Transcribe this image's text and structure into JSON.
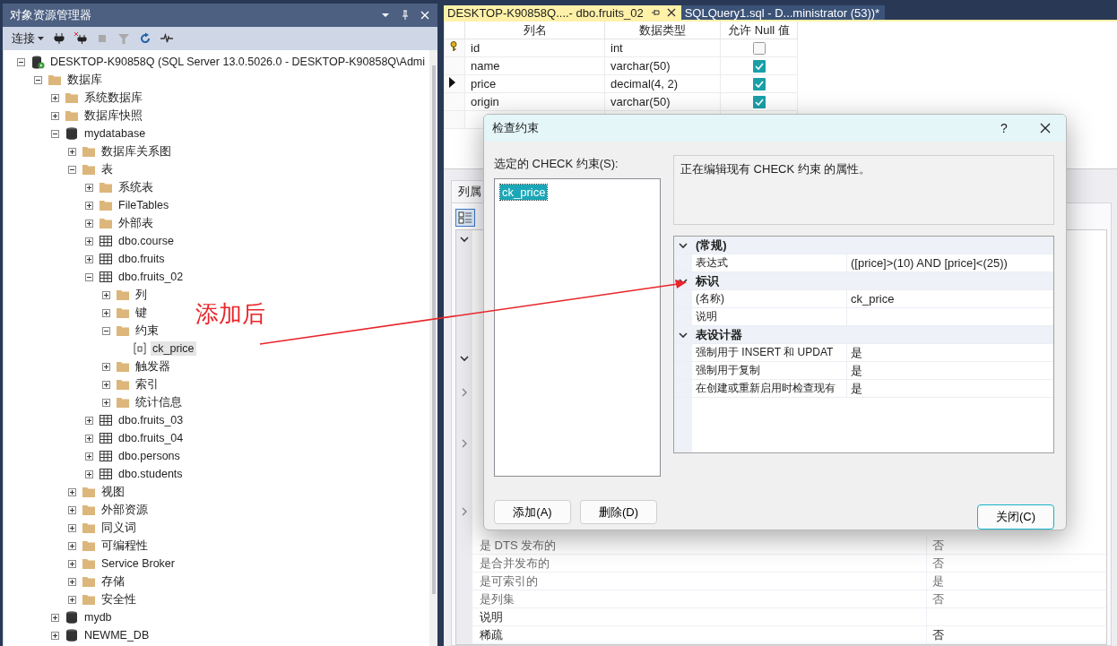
{
  "explorer": {
    "title": "对象资源管理器",
    "connect": "连接",
    "tree": [
      {
        "label": "DESKTOP-K90858Q (SQL Server 13.0.5026.0 - DESKTOP-K90858Q\\Admi",
        "kind": "server",
        "expanded": true,
        "selected": false,
        "children": [
          {
            "label": "数据库",
            "kind": "folder",
            "expanded": true,
            "selected": false,
            "children": [
              {
                "label": "系统数据库",
                "kind": "folder",
                "expanded": false,
                "selected": false
              },
              {
                "label": "数据库快照",
                "kind": "folder",
                "expanded": false,
                "selected": false
              },
              {
                "label": "mydatabase",
                "kind": "database",
                "expanded": true,
                "selected": false,
                "children": [
                  {
                    "label": "数据库关系图",
                    "kind": "folder",
                    "expanded": false,
                    "selected": false
                  },
                  {
                    "label": "表",
                    "kind": "folder",
                    "expanded": true,
                    "selected": false,
                    "children": [
                      {
                        "label": "系统表",
                        "kind": "folder",
                        "expanded": false,
                        "selected": false
                      },
                      {
                        "label": "FileTables",
                        "kind": "folder",
                        "expanded": false,
                        "selected": false
                      },
                      {
                        "label": "外部表",
                        "kind": "folder",
                        "expanded": false,
                        "selected": false
                      },
                      {
                        "label": "dbo.course",
                        "kind": "table",
                        "expanded": false,
                        "selected": false
                      },
                      {
                        "label": "dbo.fruits",
                        "kind": "table",
                        "expanded": false,
                        "selected": false
                      },
                      {
                        "label": "dbo.fruits_02",
                        "kind": "table",
                        "expanded": true,
                        "selected": false,
                        "children": [
                          {
                            "label": "列",
                            "kind": "folder",
                            "expanded": false,
                            "selected": false
                          },
                          {
                            "label": "键",
                            "kind": "folder",
                            "expanded": false,
                            "selected": false
                          },
                          {
                            "label": "约束",
                            "kind": "folder",
                            "expanded": true,
                            "selected": false,
                            "children": [
                              {
                                "label": "ck_price",
                                "kind": "constraint",
                                "selected": true
                              }
                            ]
                          },
                          {
                            "label": "触发器",
                            "kind": "folder",
                            "expanded": false,
                            "selected": false
                          },
                          {
                            "label": "索引",
                            "kind": "folder",
                            "expanded": false,
                            "selected": false
                          },
                          {
                            "label": "统计信息",
                            "kind": "folder",
                            "expanded": false,
                            "selected": false
                          }
                        ]
                      },
                      {
                        "label": "dbo.fruits_03",
                        "kind": "table",
                        "expanded": false,
                        "selected": false
                      },
                      {
                        "label": "dbo.fruits_04",
                        "kind": "table",
                        "expanded": false,
                        "selected": false
                      },
                      {
                        "label": "dbo.persons",
                        "kind": "table",
                        "expanded": false,
                        "selected": false
                      },
                      {
                        "label": "dbo.students",
                        "kind": "table",
                        "expanded": false,
                        "selected": false
                      }
                    ]
                  },
                  {
                    "label": "视图",
                    "kind": "folder",
                    "expanded": false,
                    "selected": false
                  },
                  {
                    "label": "外部资源",
                    "kind": "folder",
                    "expanded": false,
                    "selected": false
                  },
                  {
                    "label": "同义词",
                    "kind": "folder",
                    "expanded": false,
                    "selected": false
                  },
                  {
                    "label": "可编程性",
                    "kind": "folder",
                    "expanded": false,
                    "selected": false
                  },
                  {
                    "label": "Service Broker",
                    "kind": "folder",
                    "expanded": false,
                    "selected": false
                  },
                  {
                    "label": "存储",
                    "kind": "folder",
                    "expanded": false,
                    "selected": false
                  },
                  {
                    "label": "安全性",
                    "kind": "folder",
                    "expanded": false,
                    "selected": false
                  }
                ]
              },
              {
                "label": "mydb",
                "kind": "database",
                "expanded": false,
                "selected": false
              },
              {
                "label": "NEWME_DB",
                "kind": "database",
                "expanded": false,
                "selected": false
              }
            ]
          }
        ]
      }
    ]
  },
  "tabs": [
    {
      "label": "DESKTOP-K90858Q....- dbo.fruits_02",
      "selected": true
    },
    {
      "label": "SQLQuery1.sql - D...ministrator (53))*",
      "selected": false
    }
  ],
  "columns_grid": {
    "headers": [
      "列名",
      "数据类型",
      "允许 Null 值"
    ],
    "rows": [
      {
        "name": "id",
        "type": "int",
        "allow_null": false,
        "kind": "key"
      },
      {
        "name": "name",
        "type": "varchar(50)",
        "allow_null": true,
        "kind": "plain"
      },
      {
        "name": "price",
        "type": "decimal(4, 2)",
        "allow_null": true,
        "kind": "current"
      },
      {
        "name": "origin",
        "type": "varchar(50)",
        "allow_null": true,
        "kind": "plain"
      }
    ]
  },
  "column_properties": {
    "tab": "列属",
    "section_toggles": [
      {
        "expanded": true
      },
      {
        "expanded": true
      },
      {
        "expanded": false
      },
      {
        "expanded": false
      },
      {
        "expanded": false
      }
    ],
    "rows": [
      {
        "name": "是 DTS 发布的",
        "value": "否",
        "disabled": true
      },
      {
        "name": "是合并发布的",
        "value": "否",
        "disabled": true
      },
      {
        "name": "是可索引的",
        "value": "是",
        "disabled": true
      },
      {
        "name": "是列集",
        "value": "否",
        "disabled": true
      },
      {
        "name": "说明",
        "disabled": false
      },
      {
        "name": "稀疏",
        "value": "否",
        "disabled": false
      }
    ]
  },
  "dialog": {
    "title": "检查约束",
    "help": "?",
    "list_label": "选定的 CHECK 约束(S):",
    "constraints": [
      {
        "name": "ck_price",
        "selected": true
      }
    ],
    "description": "正在编辑现有 CHECK 约束 的属性。",
    "properties": [
      {
        "title": "(常规)",
        "expanded": true,
        "rows": [
          {
            "name": "表达式",
            "value": "([price]>(10) AND [price]<(25))"
          }
        ]
      },
      {
        "title": "标识",
        "expanded": true,
        "rows": [
          {
            "name": "(名称)",
            "value": "ck_price"
          },
          {
            "name": "说明"
          }
        ]
      },
      {
        "title": "表设计器",
        "expanded": true,
        "rows": [
          {
            "name": "强制用于 INSERT 和 UPDAT",
            "value": "是"
          },
          {
            "name": "强制用于复制",
            "value": "是"
          },
          {
            "name": "在创建或重新启用时检查现有",
            "value": "是"
          }
        ]
      }
    ],
    "buttons": [
      "添加(A)",
      "删除(D)"
    ],
    "close_button": "关闭(C)"
  },
  "annotation": {
    "text": "添加后"
  }
}
